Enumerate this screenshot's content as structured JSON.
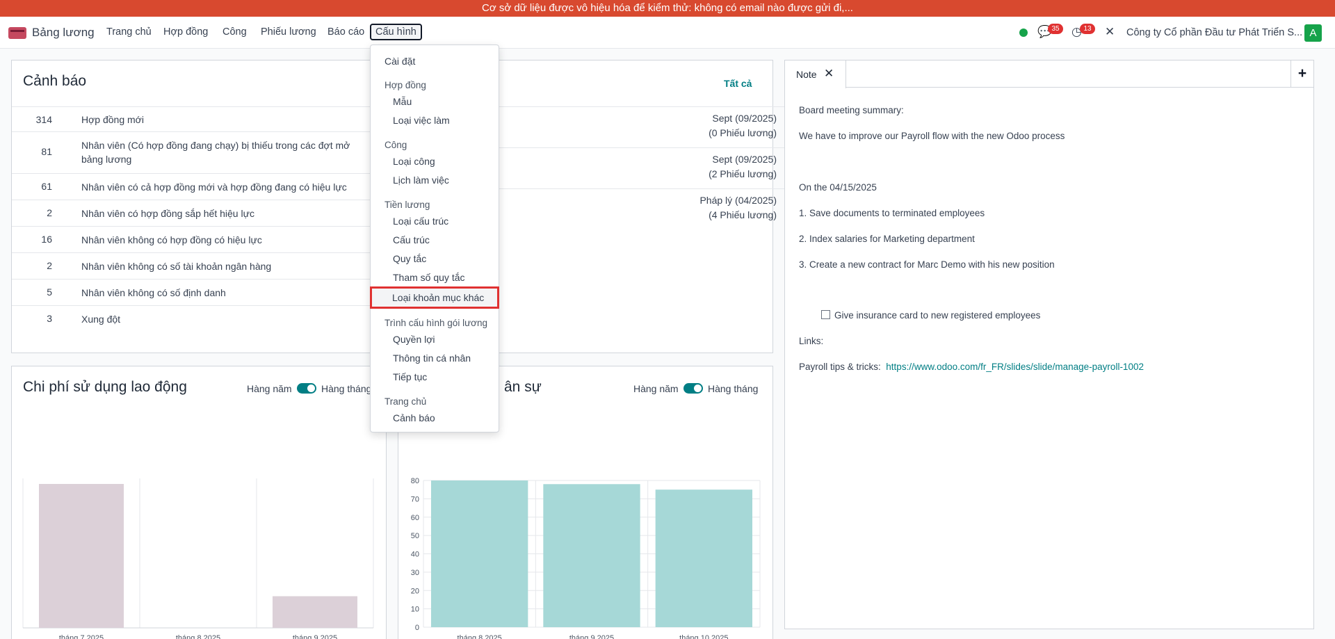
{
  "banner": "Cơ sở dữ liệu được vô hiệu hóa để kiểm thử: không có email nào được gửi đi,...",
  "navbar": {
    "app_name": "Bảng lương",
    "menu": [
      "Trang chủ",
      "Hợp đồng",
      "Công",
      "Phiếu lương",
      "Báo cáo",
      "Cấu hình"
    ],
    "messages_count": "35",
    "activities_count": "13",
    "company": "Công ty Cổ phần Đầu tư Phát Triển S...",
    "avatar_letter": "A",
    "status_color": "#16a34a"
  },
  "alerts": {
    "title": "Cảnh báo",
    "rows": [
      {
        "count": "314",
        "text": "Hợp đồng mới"
      },
      {
        "count": "81",
        "text": "Nhân viên (Có hợp đồng đang chạy) bị thiếu trong các đợt mở bảng lương"
      },
      {
        "count": "61",
        "text": "Nhân viên có cả hợp đồng mới và hợp đồng đang có hiệu lực"
      },
      {
        "count": "2",
        "text": "Nhân viên có hợp đồng sắp hết hiệu lực"
      },
      {
        "count": "16",
        "text": "Nhân viên không có hợp đồng có hiệu lực"
      },
      {
        "count": "2",
        "text": "Nhân viên không có số tài khoản ngân hàng"
      },
      {
        "count": "5",
        "text": "Nhân viên không có số định danh"
      },
      {
        "count": "3",
        "text": "Xung đột"
      }
    ]
  },
  "batches": {
    "view_all": "Tất cả",
    "rows": [
      {
        "name": "Sept (09/2025)",
        "count": "(0 Phiếu lương)"
      },
      {
        "name": "Sept (09/2025)",
        "count": "(2 Phiếu lương)"
      },
      {
        "name": "Pháp lý (04/2025)",
        "count": "(4 Phiếu lương)"
      }
    ]
  },
  "employer_cost": {
    "title": "Chi phí sử dụng lao động",
    "toggle_left": "Hàng năm",
    "toggle_right": "Hàng tháng"
  },
  "headcount": {
    "title_fragment": "ân sự",
    "toggle_left": "Hàng năm",
    "toggle_right": "Hàng tháng"
  },
  "config_menu": {
    "items": [
      {
        "type": "item",
        "label": "Cài đặt"
      },
      {
        "type": "header",
        "label": "Hợp đồng"
      },
      {
        "type": "sub",
        "label": "Mẫu"
      },
      {
        "type": "sub",
        "label": "Loại việc làm"
      },
      {
        "type": "header",
        "label": "Công"
      },
      {
        "type": "sub",
        "label": "Loại công"
      },
      {
        "type": "sub",
        "label": "Lịch làm việc"
      },
      {
        "type": "header",
        "label": "Tiền lương"
      },
      {
        "type": "sub",
        "label": "Loại cấu trúc"
      },
      {
        "type": "sub",
        "label": "Cấu trúc"
      },
      {
        "type": "sub",
        "label": "Quy tắc"
      },
      {
        "type": "sub",
        "label": "Tham số quy tắc"
      },
      {
        "type": "sub",
        "label": "Loại khoản mục khác",
        "highlighted": true
      },
      {
        "type": "header",
        "label": "Trình cấu hình gói lương"
      },
      {
        "type": "sub",
        "label": "Quyền lợi"
      },
      {
        "type": "sub",
        "label": "Thông tin cá nhân"
      },
      {
        "type": "sub",
        "label": "Tiếp tục"
      },
      {
        "type": "header",
        "label": "Trang chủ"
      },
      {
        "type": "sub",
        "label": "Cảnh báo"
      }
    ]
  },
  "note": {
    "tab_label": "Note",
    "close_icon": "close-icon",
    "add_icon": "plus-icon",
    "lines": [
      "Board meeting summary:",
      "We have to improve our Payroll flow with the new Odoo process",
      "On the 04/15/2025",
      "1. Save documents to terminated employees",
      "2. Index salaries for Marketing department",
      "3. Create a new contract for Marc Demo with his new position"
    ],
    "checkbox_text": "Give insurance card to new registered employees",
    "links_label": "Links:",
    "tips_label": "Payroll tips & tricks:",
    "tips_url": "https://www.odoo.com/fr_FR/slides/slide/manage-payroll-1002"
  },
  "chart_data": [
    {
      "type": "bar",
      "title": "Chi phí sử dụng lao động",
      "categories": [
        "tháng 7 2025",
        "tháng 8 2025",
        "tháng 9 2025"
      ],
      "values": [
        100,
        0,
        22
      ],
      "ylim": [
        0,
        100
      ],
      "color": "#dcd0d8",
      "grid": true
    },
    {
      "type": "bar",
      "categories": [
        "tháng 8 2025",
        "tháng 9 2025",
        "tháng 10 2025"
      ],
      "values": [
        80,
        78,
        75
      ],
      "yticks": [
        0,
        10,
        20,
        30,
        40,
        50,
        60,
        70,
        80
      ],
      "ylim": [
        0,
        80
      ],
      "color": "#a6d8d7",
      "grid": true
    }
  ]
}
